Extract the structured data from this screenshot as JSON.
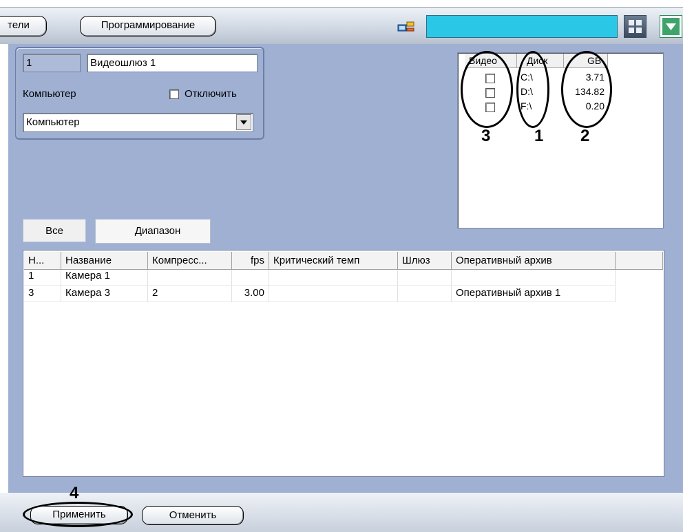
{
  "toolbar": {
    "left_tab_label": "тели",
    "programming_label": "Программирование",
    "right_icon_names": [
      "panels-icon",
      "dropdown-green-icon"
    ]
  },
  "general": {
    "id_value": "1",
    "name_value": "Видеошлюз 1",
    "computer_label": "Компьютер",
    "disable_label": "Отключить",
    "computer_select_value": "Компьютер"
  },
  "disks": {
    "headers": [
      "Видео",
      "Диск",
      "GB"
    ],
    "rows": [
      {
        "drive": "C:\\",
        "gb": "3.71"
      },
      {
        "drive": "D:\\",
        "gb": "134.82"
      },
      {
        "drive": "F:\\",
        "gb": "0.20"
      }
    ],
    "annotations": {
      "video_col": "3",
      "drive_col": "1",
      "gb_col": "2"
    }
  },
  "tabs": {
    "all": "Все",
    "range": "Диапазон"
  },
  "cameras": {
    "headers": [
      "Н...",
      "Название",
      "Компресс...",
      "fps",
      "Критический темп",
      "Шлюз",
      "Оперативный архив"
    ],
    "rows": [
      [
        "1",
        "Камера 1",
        "",
        "",
        "",
        "",
        ""
      ],
      [
        "3",
        "Камера 3",
        "2",
        "3.00",
        "",
        "",
        "Оперативный архив 1"
      ]
    ]
  },
  "footer": {
    "apply_label": "Применить",
    "cancel_label": "Отменить",
    "apply_annotation": "4"
  },
  "colors": {
    "panel_bg": "#9fb0d3",
    "accent_cyan": "#2bc7e6"
  }
}
